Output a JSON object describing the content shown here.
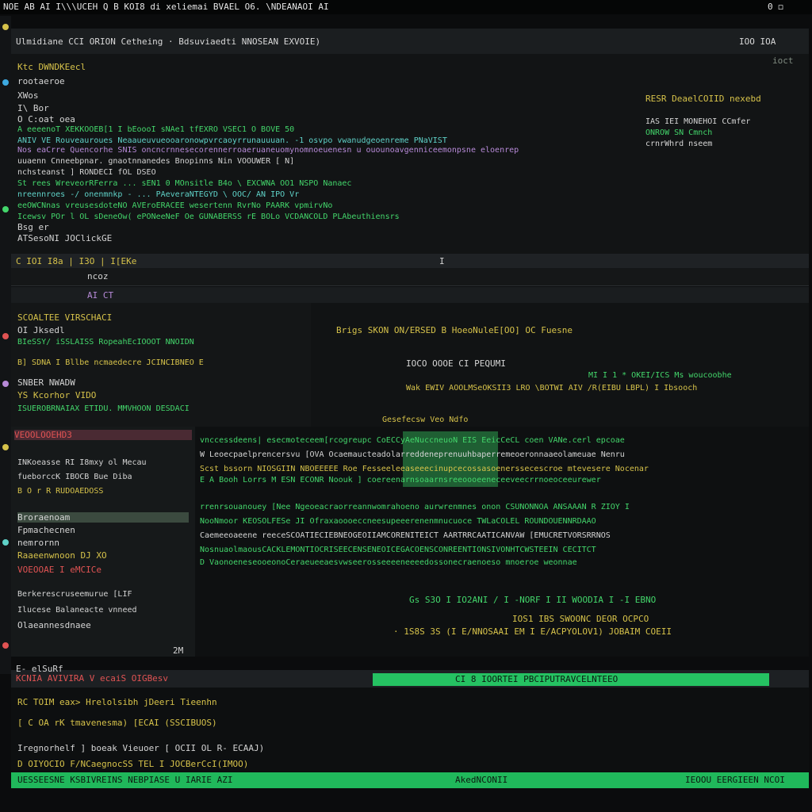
{
  "topbar": {
    "left": "NOE AB  AI I\\\\\\UCEH Q B  KOI8  di xeliemai  BVAEL O6.  \\NDEANAOI AI",
    "right": "0 ◻"
  },
  "window": {
    "title": "Ulmidiane CCI ORION  Cetheing   ·   Bdsuviaedti NNOSEAN EXVOIE)",
    "right_a": "IOO  IOA",
    "right_b": "ioct"
  },
  "top_pane": {
    "lines": [
      "Ktc  DWNDKEecl",
      "rootaeroe",
      "  XWos",
      "  I\\ Bor",
      "O C:oat  oea",
      "A  eeeenoT   XEKKOOEB[1  I bEoooI sNAe1 tfEXRO VSEC1 O  BOVE 50",
      "ANIV VE  Rouveauroues  Neaaueuvueooaronowpvrcaoyrrunauuuan. -1  osvpo  vwanudgeoenreme  PNaVIST",
      "Nos  eaCrre  Quencorhe  SNIS oncncrnnesecorennerroaeruaneuomynomnoeuenesn  u  ouounoavgenniceemonpsne  eloenrep",
      "uuaenn  Cnneebpnar.  gnaotnnanedes  Bnopinns  Nin  VOOUWER [  N]",
      "  nchsteanst  ]  RONDECI fOL  DSEO",
      "St  rees   WreveorRFerra  ... sEN1 0 MOnsitle  B4o  \\  EXCWNA  OO1 NSPO  Nanaec",
      "  nreennroes  -/  onenmnkp - ... PAeveraNTEGYD  \\  OOC/  AN  IPO  Vr",
      "  eeOWCNnas  vreusesdoteNO  AVEroERACEE  wesertenn  RvrNo  PAARK  vpmirvNo",
      "Icewsv  POr  l  OL  sDeneOw(  ePONeeNeF  Oe  GUNABERSS  rE  BOLo  VCDANCOLD  PLAbeuthiensrs",
      "Bsg er",
      "ATSesoNI  JOClickGE"
    ],
    "right_lines": [
      "RESR DeaelCOIID nexebd",
      "IAS   IEI   MONEHOI CCmfer",
      "ONROW  SN  Cmnch",
      "crnrWhrd  nseem"
    ]
  },
  "status": {
    "left": "C IOI  I8a  |  I3O  |  I[EKe",
    "mid": "ncoz",
    "right": "I"
  },
  "mid_bar": {
    "label": "AI CT"
  },
  "left_pane": {
    "lines": [
      "SCOALTEE  VIRSCHACI",
      "  OI  Jksedl",
      "BIeSSY/  iSSLAISS  RopeahEcIOOOT  NNOIDN",
      "B]  SDNA  I  Bllbe  ncmaedecre  JCINCIBNEO  E",
      "SNBER  NWADW",
      "YS Kcorhor  VIDO",
      "ISUEROBRNAIAX  ETIDU.  MMVHOON  DESDACI"
    ]
  },
  "right_pane": {
    "lines": [
      "Brigs  SKON  ON/ERSED  B  HoeoNuleE[OO]  OC Fuesne",
      "IOCO  OOOE CI  PEQUMI",
      "MI  I  1  *  OKEI/ICS  Ms  woucoobhe",
      "Wak  EWIV  AOOLMSeOKSII3  LRO   \\BOTWI AIV  /R(EIBU  LBPL)  I  Ibsooch",
      "Gesefecsw  Veo  Ndfo"
    ]
  },
  "side2": {
    "title": "VEOOLOOEHD3",
    "lines": [
      "INKoeasse  RI  I8mxy  ol  Mecau",
      "fueborccK  IBOCB  Bue  Diba",
      "  B  O  r  R  RUDOAEDOSS",
      "Broraenoam",
      "Fpmachecnen",
      "nemrornn",
      "Raaeenwnoon  DJ  XO",
      "  VOEOOAE  I  eMCICe",
      "Berkerescruseemurue  [LIF",
      "Ilucese  Balaneacte  vnneed",
      "Olaeannesdnaee"
    ]
  },
  "center": {
    "lines": [
      "vnccessdeens|  esecmoteceem[rcogreupc  CoECCyAeNuccneuoN  EIS  EeicCeCL  coen  VANe.cerl  epcoae",
      "W  Leoecpaelprencersvu  [OVA  Ocaemaucteadolarreddeneprenuuhbaperremeoeronnaaeolameuae  Nenru",
      "Scst  bssorn  NIOSGIIN  NBOEEEEE  Roe  Fesseeleeaseeecinupcecossasoenerssecescroe  mtevesere  Nocenar",
      "E  A  Booh   Lorrs  M  ESN  ECONR  Noouk  ]  coereenarnsoaarnsreeoooeeneceeveecrrnoeoceeurewer",
      "rrenrsouanouey  [Nee  Ngeoeacraorreannwomrahoeno  aurwrenmnes  onon  CSUNONNOA  ANSAAAN  R  ZIOY  I",
      "NooNmoor  KEOSOLFESe  JI  Ofraxaoooeccneesupeeerenenmnucuoce  TWLaCOLEL  ROUNDOUENNRDAAO",
      "Caemeeoaeene  reeceSCOATIECIEBNEOGEOIIAMCORENITEICT  AARTRRCAATICANVAW  [EMUCRETVORSRRNOS",
      "NosnuaolmaousCACKLEMONTIOCRISEECENSENEOICEGACOENSCONREENTIONSIVONHTCWSTEEIN  CECITCT",
      "D  VaonoeneseooeonoCeraeueeaesvwseerosseeeeneeeedossonecraenoeso  mnoeroe  weonnae"
    ],
    "footer_a": "Gs  S3O  I  IO2ANI / I  -NORF  I  II  WOODIA  I  -I  EBNO",
    "footer_b": "IOS1  IBS SWOONC  DEOR OCPCO",
    "footer_c": "·  1S8S  3S  (I  E/NNOSAAI  EM  I  E/ACPYOLOV1)  JOBAIM  COEII",
    "left_mark": "2M"
  },
  "tagstrip": {
    "left": "KCNIA  AVIVIRA  V ecaiS  OIGBesv",
    "green": "CI  8     IOORTEI  PBCIPUTRAVCELNTEEO"
  },
  "terminal": {
    "header": "E-  elSuRf",
    "lines": [
      "RC TOIM  eax>  Hrelolsibh  jDeeri  Tieenhn",
      "[ C  OA  rK  tmavenesma)  [ECAI  (SSCIBUOS)",
      "Iregnorhelf  ]  boeak  Vieuoer  [  OCII  OL  R-  ECAAJ)",
      "D  OIYOCIO  F/NCaegnocSS  TEL  I  JOCBerCcI(IMOO)"
    ]
  },
  "bottombar": {
    "left": "UESSEESNE  KSBIVREINS  NEBPIASE  U  IARIE  AZI",
    "mid": "AkedNCONII",
    "right": "IEOOU  EERGIEEN  NCOI"
  }
}
